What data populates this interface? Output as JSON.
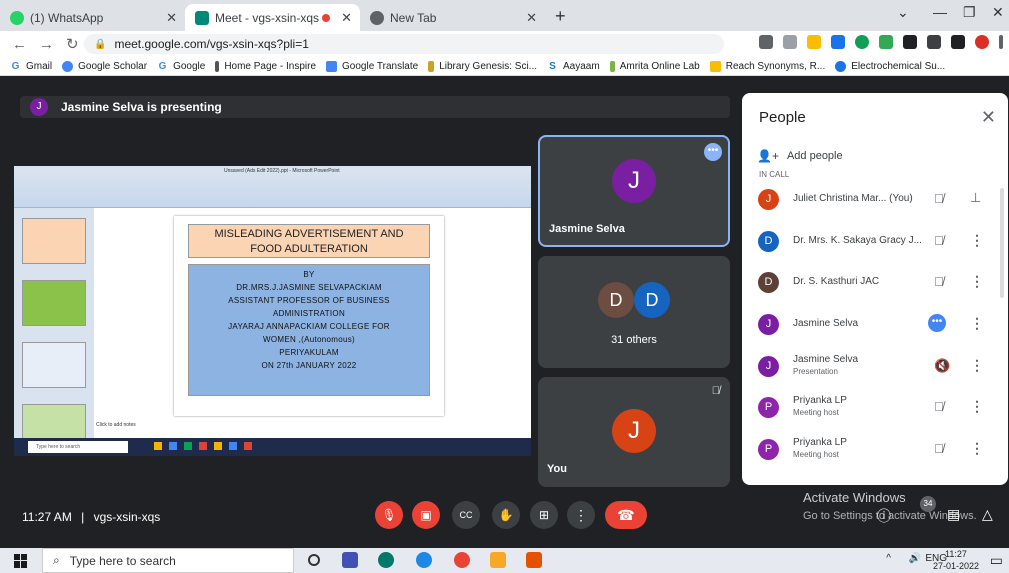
{
  "browser": {
    "tabs": [
      {
        "label": "(1) WhatsApp",
        "favicon_color": "#25d366"
      },
      {
        "label": "Meet - vgs-xsin-xqs",
        "favicon_color": "#00897b"
      },
      {
        "label": "New Tab",
        "favicon_color": "#5f6368"
      }
    ],
    "new_tab_label": "+",
    "url": "meet.google.com/vgs-xsin-xqs?pli=1",
    "bookmarks": [
      "Gmail",
      "Google Scholar",
      "Google",
      "Home Page - Inspire",
      "Google Translate",
      "Library Genesis: Sci...",
      "Aayaam",
      "Amrita Online Lab",
      "Reach Synonyms, R...",
      "Electrochemical Su..."
    ]
  },
  "meet": {
    "presenting_initial": "J",
    "presenting_text": "Jasmine Selva is presenting",
    "slide": {
      "ppt_title": "Unsaved (Ads Edit 2022).ppt - Microsoft PowerPoint",
      "title_line1": "MISLEADING ADVERTISEMENT AND",
      "title_line2": "FOOD ADULTERATION",
      "body": [
        "BY",
        "DR.MRS.J.JASMINE SELVAPACKIAM",
        "ASSISTANT PROFESSOR OF BUSINESS",
        "ADMINISTRATION",
        "JAYARAJ ANNAPACKIAM COLLEGE FOR",
        "WOMEN ,(Autonomous)",
        "PERIYAKULAM",
        "ON 27th JANUARY 2022"
      ],
      "notes": "Click to add notes",
      "taskbar_search": "Type here to search"
    },
    "tiles": {
      "presenter_initial": "J",
      "presenter_name": "Jasmine Selva",
      "others_initials": [
        "D",
        "D"
      ],
      "others_label": "31 others",
      "you_initial": "J",
      "you_label": "You"
    },
    "time": "11:27 AM",
    "separator": "|",
    "meeting_code": "vgs-xsin-xqs",
    "activate_title": "Activate Windows",
    "activate_sub": "Go to Settings to activate Windows.",
    "participant_count": "34"
  },
  "people": {
    "title": "People",
    "add_people": "Add people",
    "section": "IN CALL",
    "rows": [
      {
        "initial": "J",
        "name": "Juliet Christina Mar...  (You)",
        "sub": "",
        "color": "#d84315"
      },
      {
        "initial": "D",
        "name": "Dr. Mrs. K. Sakaya Gracy J...",
        "sub": "",
        "color": "#1565c0"
      },
      {
        "initial": "D",
        "name": "Dr. S. Kasthuri JAC",
        "sub": "",
        "color": "#5d4037"
      },
      {
        "initial": "J",
        "name": "Jasmine Selva",
        "sub": "",
        "color": "#7b1fa2"
      },
      {
        "initial": "J",
        "name": "Jasmine Selva",
        "sub": "Presentation",
        "color": "#7b1fa2"
      },
      {
        "initial": "P",
        "name": "Priyanka LP",
        "sub": "Meeting host",
        "color": "#8e24aa"
      },
      {
        "initial": "P",
        "name": "Priyanka LP",
        "sub": "Meeting host",
        "color": "#8e24aa"
      }
    ]
  },
  "taskbar": {
    "search": "Type here to search",
    "lang": "ENG",
    "time": "11:27",
    "date": "27-01-2022"
  }
}
